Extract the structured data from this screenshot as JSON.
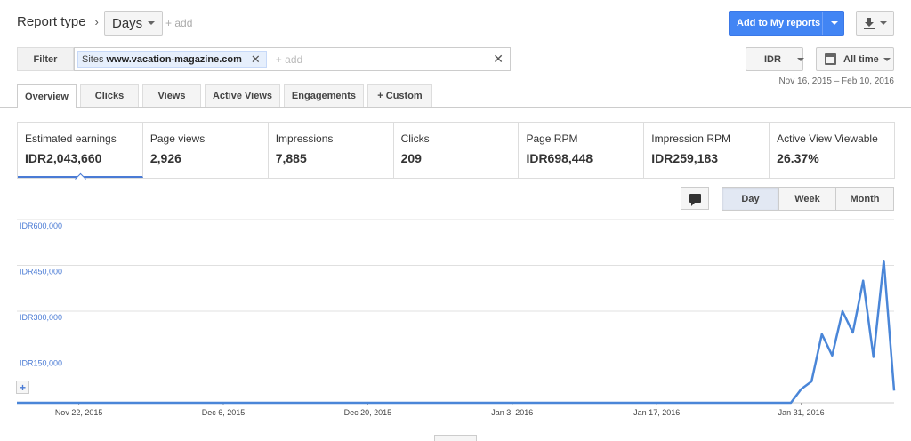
{
  "header": {
    "report_type": "Report type",
    "granularity_select": "Days",
    "add_label": "+ add",
    "add_to_reports": "Add to My reports"
  },
  "filter": {
    "button_label": "Filter",
    "chip_key": "Sites",
    "chip_value": "www.vacation-magazine.com",
    "add_placeholder": "+ add"
  },
  "currency": "IDR",
  "time_range": "All time",
  "date_range": "Nov 16, 2015 – Feb 10, 2016",
  "tabs": [
    {
      "label": "Overview",
      "active": true
    },
    {
      "label": "Clicks"
    },
    {
      "label": "Views"
    },
    {
      "label": "Active Views"
    },
    {
      "label": "Engagements"
    },
    {
      "label": "+ Custom"
    }
  ],
  "metrics": [
    {
      "label": "Estimated earnings",
      "value": "IDR2,043,660",
      "active": true
    },
    {
      "label": "Page views",
      "value": "2,926"
    },
    {
      "label": "Impressions",
      "value": "7,885"
    },
    {
      "label": "Clicks",
      "value": "209"
    },
    {
      "label": "Page RPM",
      "value": "IDR698,448"
    },
    {
      "label": "Impression RPM",
      "value": "IDR259,183"
    },
    {
      "label": "Active View Viewable",
      "value": "26.37%"
    }
  ],
  "granularity": [
    {
      "label": "Day",
      "active": true
    },
    {
      "label": "Week"
    },
    {
      "label": "Month"
    }
  ],
  "icons": {
    "report_chevron": "chevron-right-icon",
    "download": "download-icon",
    "calendar": "calendar-icon",
    "annotation": "comment-icon",
    "zoom": "zoom-icon",
    "chip_remove": "close-icon",
    "clear_filter": "close-icon"
  },
  "colors": {
    "accent": "#4285f4",
    "series_line": "#4a86d8",
    "axis_text": "#4a7bd5"
  },
  "chart_data": {
    "type": "line",
    "title": "",
    "xlabel": "",
    "ylabel": "",
    "ylim": [
      0,
      600000
    ],
    "yticks": [
      150000,
      300000,
      450000,
      600000
    ],
    "ytick_labels": [
      "IDR150,000",
      "IDR300,000",
      "IDR450,000",
      "IDR600,000"
    ],
    "xtick_labels": [
      "Nov 22, 2015",
      "Dec 6, 2015",
      "Dec 20, 2015",
      "Jan 3, 2016",
      "Jan 17, 2016",
      "Jan 31, 2016"
    ],
    "xtick_days": [
      6,
      20,
      34,
      48,
      62,
      76
    ],
    "x_start": "2015-11-16",
    "grid": true,
    "series": [
      {
        "values": [
          0,
          0,
          0,
          0,
          0,
          0,
          0,
          0,
          0,
          0,
          0,
          0,
          0,
          0,
          0,
          0,
          0,
          0,
          0,
          0,
          0,
          0,
          0,
          0,
          0,
          0,
          0,
          0,
          0,
          0,
          0,
          0,
          0,
          0,
          0,
          0,
          0,
          0,
          0,
          0,
          0,
          0,
          0,
          0,
          0,
          0,
          0,
          0,
          0,
          0,
          0,
          0,
          0,
          0,
          0,
          0,
          0,
          0,
          0,
          0,
          0,
          0,
          0,
          0,
          0,
          0,
          0,
          0,
          0,
          0,
          0,
          0,
          0,
          0,
          0,
          0,
          45000,
          70000,
          225000,
          155000,
          300000,
          230000,
          400000,
          150000,
          465000,
          40000
        ]
      }
    ]
  }
}
